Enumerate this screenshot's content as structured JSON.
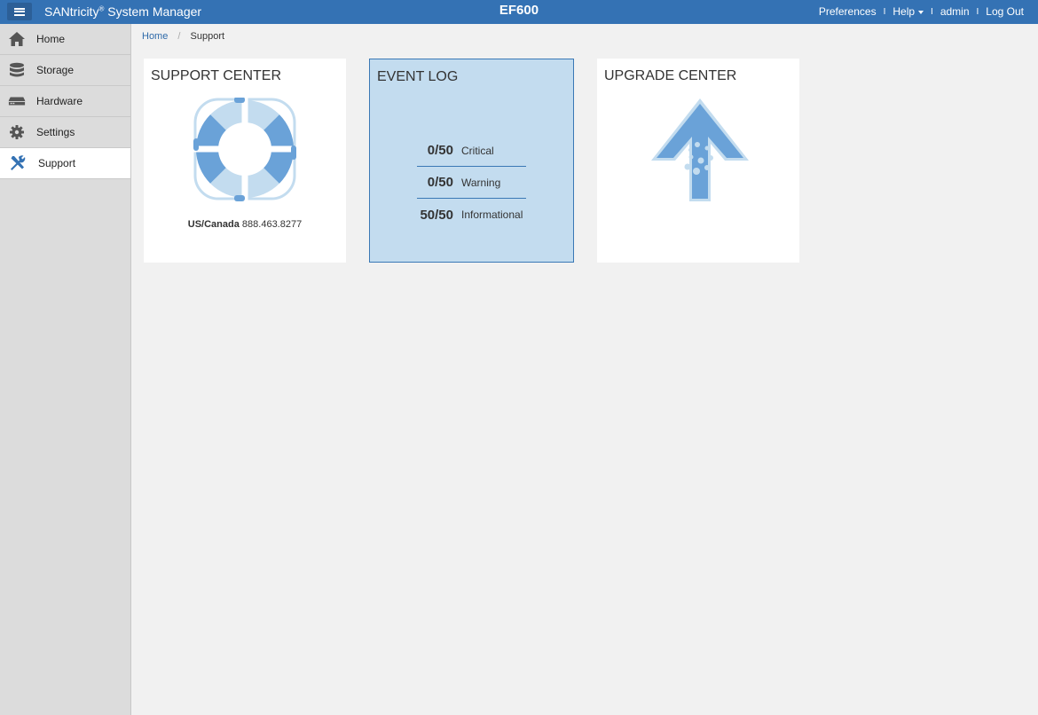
{
  "header": {
    "menu_icon": "hamburger-menu-icon",
    "app_name": "SANtricity",
    "app_reg": "®",
    "app_suffix": " System Manager",
    "system_name": "EF600",
    "links": {
      "preferences": "Preferences",
      "help": "Help",
      "user": "admin",
      "logout": "Log Out"
    },
    "separator": "I"
  },
  "sidebar": {
    "items": [
      {
        "label": "Home",
        "icon": "home-icon"
      },
      {
        "label": "Storage",
        "icon": "database-icon"
      },
      {
        "label": "Hardware",
        "icon": "hardware-icon"
      },
      {
        "label": "Settings",
        "icon": "gear-icon"
      },
      {
        "label": "Support",
        "icon": "tools-icon",
        "active": true
      }
    ]
  },
  "breadcrumb": {
    "home": "Home",
    "separator": "/",
    "current": "Support"
  },
  "tiles": {
    "support_center": {
      "title": "SUPPORT CENTER",
      "icon": "lifebuoy-icon",
      "region": "US/Canada",
      "phone": "888.463.8277"
    },
    "event_log": {
      "title": "EVENT LOG",
      "events": [
        {
          "count": "0/50",
          "label": "Critical"
        },
        {
          "count": "0/50",
          "label": "Warning"
        },
        {
          "count": "50/50",
          "label": "Informational"
        }
      ]
    },
    "upgrade_center": {
      "title": "UPGRADE CENTER",
      "icon": "upgrade-arrow-icon"
    }
  },
  "colors": {
    "header_bg": "#3472b4",
    "accent": "#3a78b5",
    "tile_selected_bg": "#c3dcef",
    "icon_blue": "#6aa2d8",
    "icon_light": "#c3dcef"
  }
}
